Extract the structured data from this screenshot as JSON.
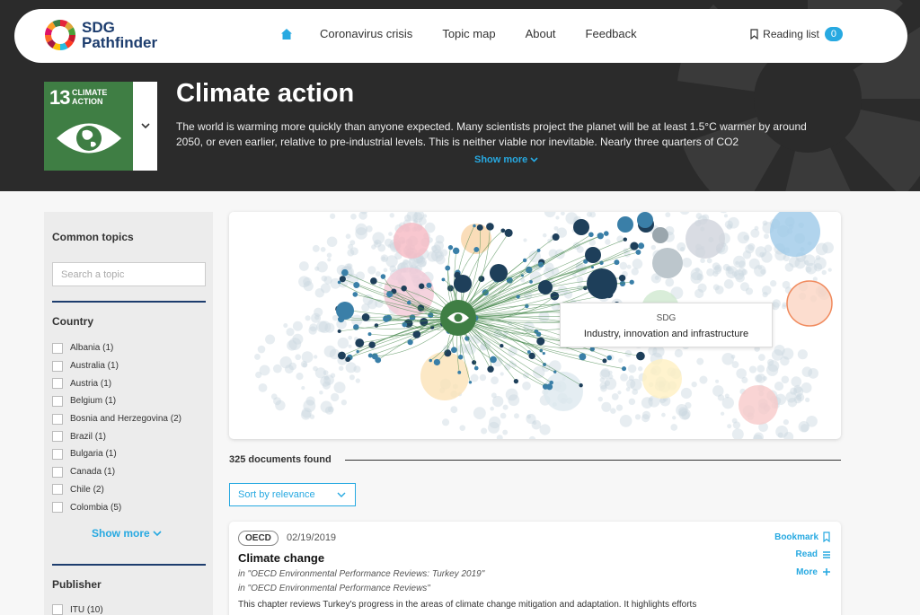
{
  "brand": {
    "name_line1": "SDG",
    "name_line2": "Pathfinder"
  },
  "nav": {
    "home_icon": "home-icon",
    "items": [
      "Coronavirus crisis",
      "Topic map",
      "About",
      "Feedback"
    ],
    "reading_list": "Reading list",
    "reading_count": "0"
  },
  "hero": {
    "sdg_number": "13",
    "sdg_label_line1": "CLIMATE",
    "sdg_label_line2": "ACTION",
    "title": "Climate action",
    "description": "The world is warming more quickly than anyone expected. Many scientists project the planet will be at least 1.5°C warmer by around 2050, or even earlier, relative to pre-industrial levels. This is neither viable nor inevitable. Nearly three quarters of CO2",
    "show_more": "Show more"
  },
  "sidebar": {
    "common_topics": "Common topics",
    "search_placeholder": "Search a topic",
    "country_heading": "Country",
    "countries": [
      "Albania (1)",
      "Australia (1)",
      "Austria (1)",
      "Belgium (1)",
      "Bosnia and Herzegovina (2)",
      "Brazil (1)",
      "Bulgaria (1)",
      "Canada (1)",
      "Chile (2)",
      "Colombia (5)"
    ],
    "show_more": "Show more",
    "publisher_heading": "Publisher",
    "publishers": [
      "ITU (10)"
    ]
  },
  "map": {
    "tooltip_head": "SDG",
    "tooltip_body": "Industry, innovation and infrastructure",
    "colors": {
      "climate": "#3f7e44",
      "node_dark": "#1e3f5a",
      "node_blue": "#3a7fa8",
      "bubble": "#c9d6e0"
    }
  },
  "results": {
    "count": "325 documents found",
    "sort_label": "Sort by relevance",
    "card": {
      "publisher": "OECD",
      "date": "02/19/2019",
      "title": "Climate change",
      "in_line1": "in \"OECD Environmental Performance Reviews: Turkey 2019\"",
      "in_line2": "in \"OECD Environmental Performance Reviews\"",
      "snippet": "This chapter reviews Turkey's progress in the areas of climate change mitigation and adaptation. It highlights efforts",
      "bookmark": "Bookmark",
      "read": "Read",
      "more": "More"
    }
  },
  "colors": {
    "accent": "#27a9e1",
    "brand": "#1d3d6e",
    "hero_bg": "#2b2b2b"
  }
}
